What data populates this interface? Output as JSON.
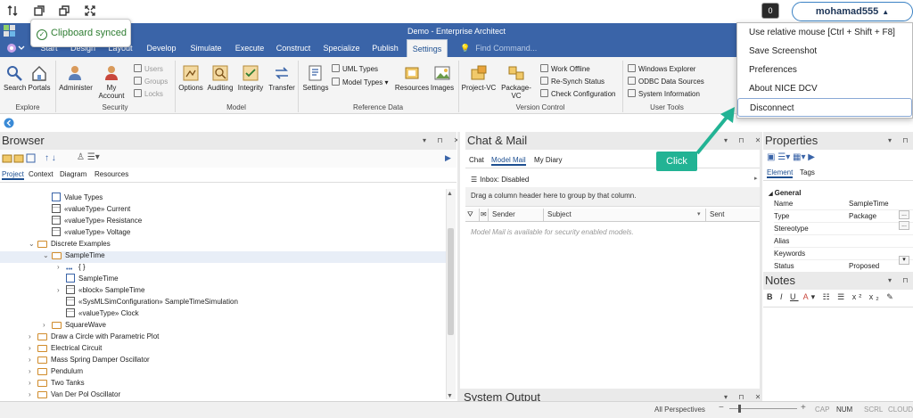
{
  "dcv": {
    "icons": [
      "sort-arrows-icon",
      "copy-window-icon",
      "restore-window-icon",
      "fullscreen-icon"
    ],
    "notification_count": "0",
    "username": "mohamad555"
  },
  "toast": {
    "text": "Clipboard synced"
  },
  "window": {
    "title": "Demo - Enterprise Architect"
  },
  "tabs": [
    "Start",
    "Design",
    "Layout",
    "Develop",
    "Simulate",
    "Execute",
    "Construct",
    "Specialize",
    "Publish",
    "Settings"
  ],
  "find_command": "Find Command...",
  "ribbon": {
    "explore": {
      "label": "Explore",
      "buttons": [
        "Search",
        "Portals"
      ]
    },
    "security": {
      "label": "Security",
      "buttons": [
        "Administer",
        "My Account"
      ],
      "small": [
        "Users",
        "Groups",
        "Locks"
      ]
    },
    "model": {
      "label": "Model",
      "buttons": [
        "Options",
        "Auditing",
        "Integrity",
        "Transfer"
      ]
    },
    "reference": {
      "label": "Reference Data",
      "buttons": [
        "Settings",
        "Resources",
        "Images"
      ],
      "small": [
        "UML Types",
        "Model Types"
      ]
    },
    "version": {
      "label": "Version Control",
      "buttons": [
        "Project-VC",
        "Package-VC"
      ],
      "small": [
        "Work Offline",
        "Re-Synch Status",
        "Check Configuration"
      ]
    },
    "usertools": {
      "label": "User Tools",
      "small": [
        "Windows Explorer",
        "ODBC Data Sources",
        "System Information"
      ]
    }
  },
  "browser": {
    "title": "Browser",
    "subtabs": [
      "Project",
      "Context",
      "Diagram",
      "Resources"
    ],
    "tree": [
      {
        "label": "Value Types",
        "indent": 3,
        "icon": "diagram",
        "arrow": ""
      },
      {
        "label": "«valueType» Current",
        "indent": 3,
        "icon": "class",
        "arrow": ""
      },
      {
        "label": "«valueType» Resistance",
        "indent": 3,
        "icon": "class",
        "arrow": ""
      },
      {
        "label": "«valueType» Voltage",
        "indent": 3,
        "icon": "class",
        "arrow": ""
      },
      {
        "label": "Discrete Examples",
        "indent": 2,
        "icon": "folder",
        "arrow": "⌄"
      },
      {
        "label": "SampleTime",
        "indent": 3,
        "icon": "folder",
        "arrow": "⌄",
        "selected": true
      },
      {
        "label": "{ }",
        "indent": 4,
        "icon": "dots",
        "arrow": "›"
      },
      {
        "label": "SampleTime",
        "indent": 4,
        "icon": "diagram",
        "arrow": ""
      },
      {
        "label": "«block» SampleTime",
        "indent": 4,
        "icon": "class",
        "arrow": "›"
      },
      {
        "label": "«SysMLSimConfiguration» SampleTimeSimulation",
        "indent": 4,
        "icon": "class",
        "arrow": ""
      },
      {
        "label": "«valueType» Clock",
        "indent": 4,
        "icon": "class",
        "arrow": ""
      },
      {
        "label": "SquareWave",
        "indent": 3,
        "icon": "folder",
        "arrow": "›"
      },
      {
        "label": "Draw a Circle with Parametric Plot",
        "indent": 2,
        "icon": "folder",
        "arrow": "›"
      },
      {
        "label": "Electrical Circuit",
        "indent": 2,
        "icon": "folder",
        "arrow": "›"
      },
      {
        "label": "Mass Spring Damper Oscillator",
        "indent": 2,
        "icon": "folder",
        "arrow": "›"
      },
      {
        "label": "Pendulum",
        "indent": 2,
        "icon": "folder",
        "arrow": "›"
      },
      {
        "label": "Two Tanks",
        "indent": 2,
        "icon": "folder",
        "arrow": "›"
      },
      {
        "label": "Van Der Pol Oscillator",
        "indent": 2,
        "icon": "folder",
        "arrow": "›"
      }
    ]
  },
  "chat": {
    "title": "Chat & Mail",
    "subtabs": [
      "Chat",
      "Model Mail",
      "My Diary"
    ],
    "inbox": "Inbox: Disabled",
    "group_hint": "Drag a column header here to group by that column.",
    "columns": [
      "Sender",
      "Subject",
      "Sent"
    ],
    "empty": "Model Mail is available for security enabled models."
  },
  "system_output": {
    "title": "System Output"
  },
  "properties": {
    "title": "Properties",
    "subtabs": [
      "Element",
      "Tags"
    ],
    "group": "General",
    "rows": [
      {
        "name": "Name",
        "value": "SampleTime"
      },
      {
        "name": "Type",
        "value": "Package"
      },
      {
        "name": "Stereotype",
        "value": ""
      },
      {
        "name": "Alias",
        "value": ""
      },
      {
        "name": "Keywords",
        "value": ""
      },
      {
        "name": "Status",
        "value": "Proposed"
      }
    ]
  },
  "notes": {
    "title": "Notes"
  },
  "menu": [
    "Use relative mouse [Ctrl + Shift + F8]",
    "Save Screenshot",
    "Preferences",
    "About NICE DCV",
    "Disconnect"
  ],
  "annotation": {
    "text": "Click",
    "color": "#22b394"
  },
  "status": {
    "perspectives": "All Perspectives",
    "indicators": [
      "CAP",
      "NUM",
      "SCRL",
      "CLOUD"
    ]
  }
}
